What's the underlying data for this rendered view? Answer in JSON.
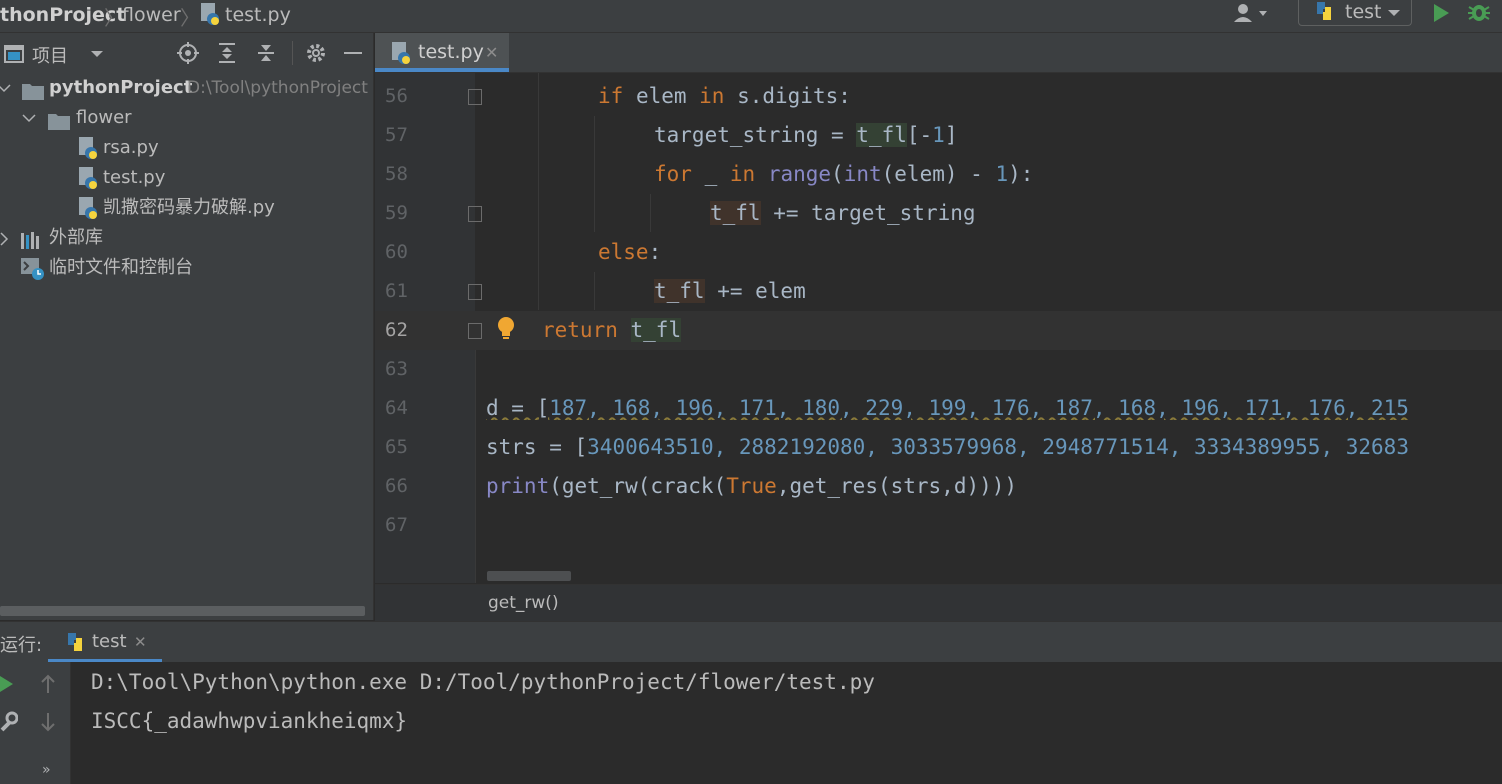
{
  "navbar": {
    "crumbs": [
      "thonProject",
      "flower",
      "test.py"
    ],
    "run_config": "test"
  },
  "project_panel": {
    "title": "项目",
    "tree": {
      "root": {
        "label": "pythonProject",
        "hint": "D:\\Tool\\pythonProject"
      },
      "folder": "flower",
      "files": [
        "rsa.py",
        "test.py",
        "凯撒密码暴力破解.py"
      ],
      "external": "外部库",
      "scratch": "临时文件和控制台"
    }
  },
  "editor": {
    "tab": "test.py",
    "line_numbers": [
      "56",
      "57",
      "58",
      "59",
      "60",
      "61",
      "62",
      "63",
      "64",
      "65",
      "66",
      "67"
    ],
    "current_line": "62",
    "lines": {
      "l56": {
        "kw1": "if",
        "t1": " elem ",
        "kw2": "in",
        "t2": " s.digits:"
      },
      "l57": {
        "t1": "target_string = ",
        "hl": "t_fl",
        "t2": "[-",
        "n1": "1",
        "t3": "]"
      },
      "l58": {
        "kw1": "for",
        "t1": " _ ",
        "kw2": "in",
        "t2": " ",
        "b1": "range",
        "t3": "(",
        "b2": "int",
        "t4": "(elem) - ",
        "n1": "1",
        "t5": "):"
      },
      "l59": {
        "hl": "t_fl",
        "t1": " += target_string"
      },
      "l60": {
        "kw1": "else",
        "t1": ":"
      },
      "l61": {
        "hl": "t_fl",
        "t1": " += elem"
      },
      "l62": {
        "kw1": "return",
        "t1": " ",
        "hl": "t_fl"
      },
      "l64": {
        "t1": "d = [",
        "nums": "187, 168, 196, 171, 180, 229, 199, 176, 187, 168, 196, 171, 176, 215"
      },
      "l65": {
        "t1": "strs = [",
        "nums": "3400643510, 2882192080, 3033579968, 2948771514, 3334389955, 32683"
      },
      "l66": {
        "b1": "print",
        "t1": "(get_rw(crack(",
        "kw1": "True",
        "t2": ",get_res(strs,d))))"
      }
    },
    "breadcrumb": "get_rw()"
  },
  "run": {
    "label": "运行:",
    "tab": "test",
    "output": [
      "D:\\Tool\\Python\\python.exe D:/Tool/pythonProject/flower/test.py",
      "ISCC{_adawhwpviankheiqmx}"
    ]
  },
  "colors": {
    "accent": "#4a88c7",
    "keyword": "#cc7832",
    "number": "#6897bb",
    "builtin": "#8888c6",
    "run_green": "#499c54"
  }
}
